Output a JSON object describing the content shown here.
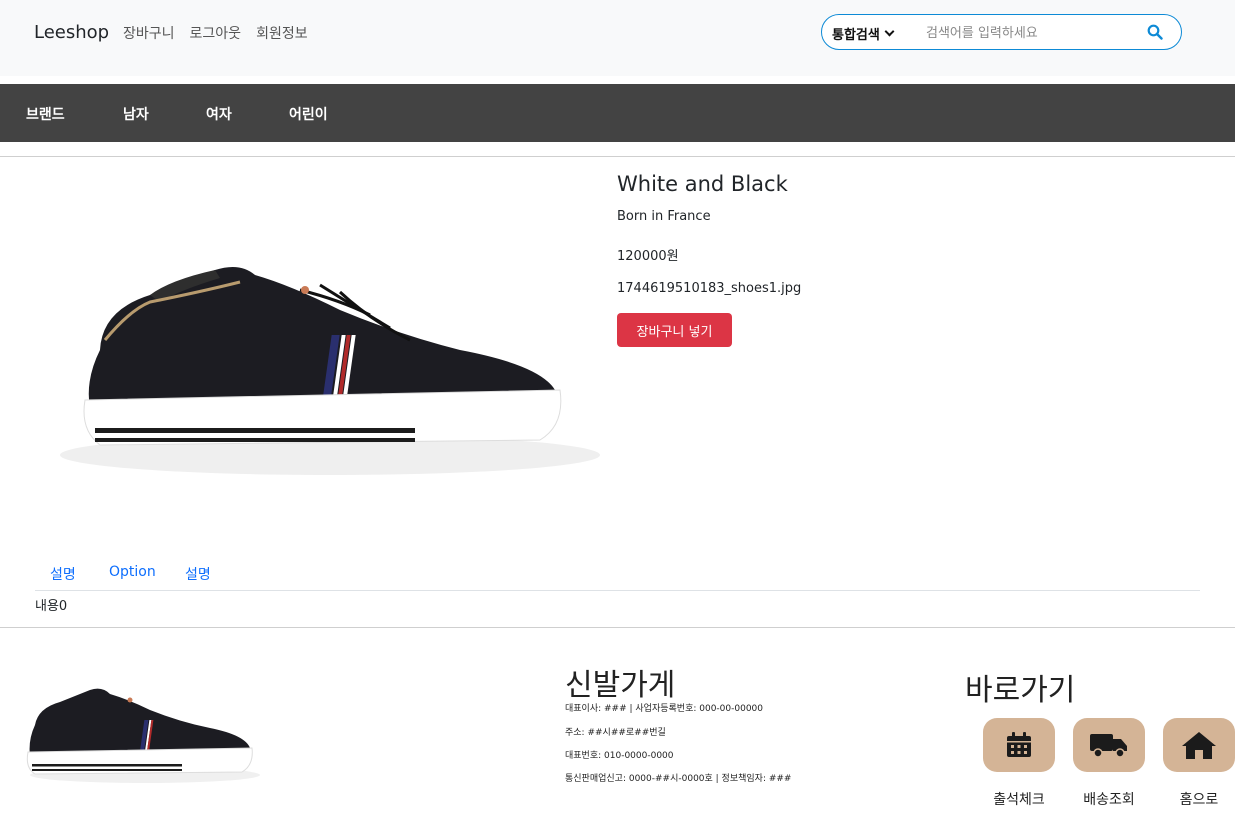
{
  "header": {
    "brand": "Leeshop",
    "nav": [
      "장바구니",
      "로그아웃",
      "회원정보"
    ],
    "search": {
      "selected_option": "통합검색",
      "placeholder": "검색어를 입력하세요",
      "accent": "#0d8ad6",
      "icon": "search-icon"
    }
  },
  "categories": [
    "브랜드",
    "남자",
    "여자",
    "어린이"
  ],
  "product": {
    "title": "White and Black",
    "description": "Born in France",
    "price": "120000원",
    "filename": "1744619510183_shoes1.jpg",
    "cart_button": "장바구니 넣기",
    "cart_button_color": "#dc3545"
  },
  "tabs": {
    "items": [
      "설명",
      "Option",
      "설명"
    ],
    "content": "내용0"
  },
  "footer": {
    "shop_name": "신발가게",
    "info": [
      "대표이사: ### | 사업자등록번호: 000-00-00000",
      "주소: ##시##로##번길",
      "대표번호: 010-0000-0000",
      "통신판매업신고: 0000-##시-0000호 | 정보책임자: ###"
    ],
    "quick_title": "바로가기",
    "quick_links": [
      {
        "label": "출석체크",
        "icon": "calendar-icon"
      },
      {
        "label": "배송조회",
        "icon": "truck-icon"
      },
      {
        "label": "홈으로",
        "icon": "home-icon"
      }
    ],
    "quick_color": "#d4b496"
  }
}
